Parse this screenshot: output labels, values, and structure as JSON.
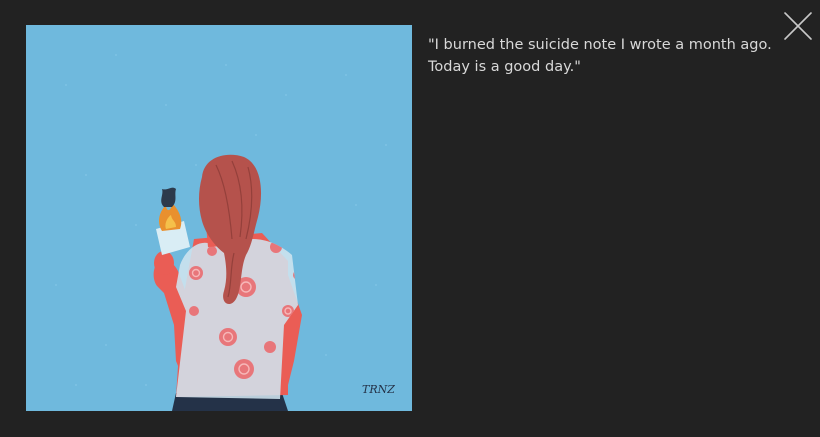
{
  "lightbox": {
    "caption": "\"I burned the suicide note I wrote a month ago. Today is a good day.\"",
    "close_icon": "close-icon",
    "artwork": {
      "signature": "TRNZ",
      "colors": {
        "background": "#6fb9dd",
        "hair": "#b5524c",
        "skin": "#ea5d55",
        "shirt": "#cfe4ef",
        "rose": "#e8767a",
        "pants": "#243248",
        "flame": "#e9902e"
      }
    },
    "colors": {
      "overlay_background": "#222222",
      "caption_text": "#d8d8d8",
      "close_icon": "#c8c8c8"
    }
  }
}
